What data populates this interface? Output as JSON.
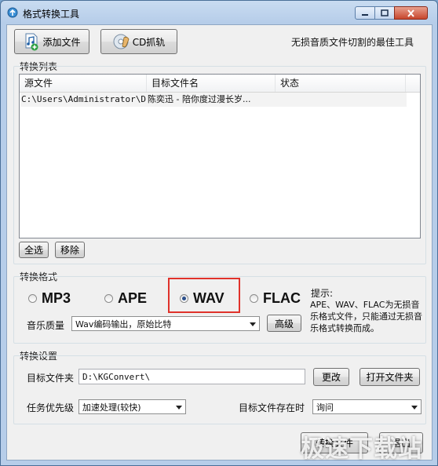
{
  "window": {
    "title": "格式转换工具",
    "controls": [
      "minimize-icon",
      "maximize-icon",
      "close-icon"
    ]
  },
  "toolbar": {
    "add_file_label": "添加文件",
    "cd_rip_label": "CD抓轨",
    "tagline": "无损音质文件切割的最佳工具"
  },
  "file_list": {
    "group_label": "转换列表",
    "columns": [
      "源文件",
      "目标文件名",
      "状态"
    ],
    "rows": [
      {
        "source": "C:\\Users\\Administrator\\D...",
        "target": "陈奕迅 - 陪你度过漫长岁...",
        "status": ""
      }
    ],
    "select_all_label": "全选",
    "remove_label": "移除"
  },
  "format": {
    "group_label": "转换格式",
    "options": [
      "MP3",
      "APE",
      "WAV",
      "FLAC"
    ],
    "selected": "WAV",
    "quality_label": "音乐质量",
    "quality_value": "Wav编码输出，原始比特",
    "advanced_label": "高级",
    "hint_title": "提示:",
    "hint_body": "APE、WAV、FLAC为无损音乐格式文件，只能通过无损音乐格式转换而成。",
    "highlight_color": "#e0322b"
  },
  "settings": {
    "group_label": "转换设置",
    "target_folder_label": "目标文件夹",
    "target_folder_value": "D:\\KGConvert\\",
    "change_label": "更改",
    "open_folder_label": "打开文件夹",
    "priority_label": "任务优先级",
    "priority_value": "加速处理(较快)",
    "exists_label": "目标文件存在时",
    "exists_value": "询问"
  },
  "footer": {
    "convert_label": "转换文件",
    "exit_label": "退出",
    "watermark": "极速下载站"
  }
}
